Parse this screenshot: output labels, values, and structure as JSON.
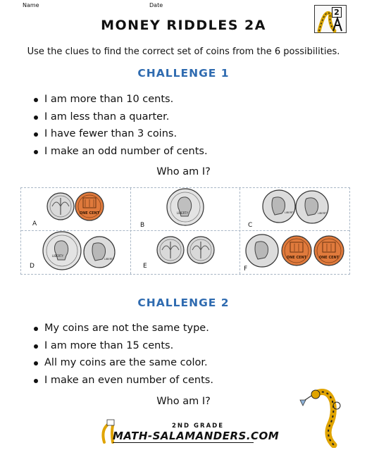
{
  "header": {
    "name_label": "Name",
    "date_label": "Date"
  },
  "logo": {
    "grade_number": "2"
  },
  "title": "MONEY RIDDLES 2A",
  "intro": "Use the clues to find the correct set of coins from the 6 possibilities.",
  "challenge1": {
    "heading": "CHALLENGE 1",
    "clues": [
      "I am more than 10 cents.",
      "I am less than a quarter.",
      "I have fewer than 3 coins.",
      "I make an odd number of cents."
    ],
    "question": "Who am I?"
  },
  "coin_options": [
    {
      "label": "A",
      "coins": [
        "dime",
        "penny"
      ]
    },
    {
      "label": "B",
      "coins": [
        "quarter"
      ]
    },
    {
      "label": "C",
      "coins": [
        "nickel",
        "nickel"
      ]
    },
    {
      "label": "D",
      "coins": [
        "quarter",
        "nickel"
      ]
    },
    {
      "label": "E",
      "coins": [
        "dime",
        "dime"
      ]
    },
    {
      "label": "F",
      "coins": [
        "nickel",
        "penny",
        "penny"
      ]
    }
  ],
  "coin_text": {
    "penny": "ONE CENT",
    "quarter": "LIBERTY",
    "nickel": "LIBERTY"
  },
  "challenge2": {
    "heading": "CHALLENGE 2",
    "clues": [
      "My coins are not the same type.",
      "I am more than 15 cents.",
      "All my coins are the same color.",
      "I make an even number of cents."
    ],
    "question": "Who am I?"
  },
  "footer": {
    "grade": "2ND GRADE",
    "site": "MATH-SALAMANDERS.COM"
  },
  "colors": {
    "heading_blue": "#2f6bb0",
    "copper": "#e07a3c",
    "silver": "#d9d9d9",
    "grid_border": "#a9b7c6"
  }
}
